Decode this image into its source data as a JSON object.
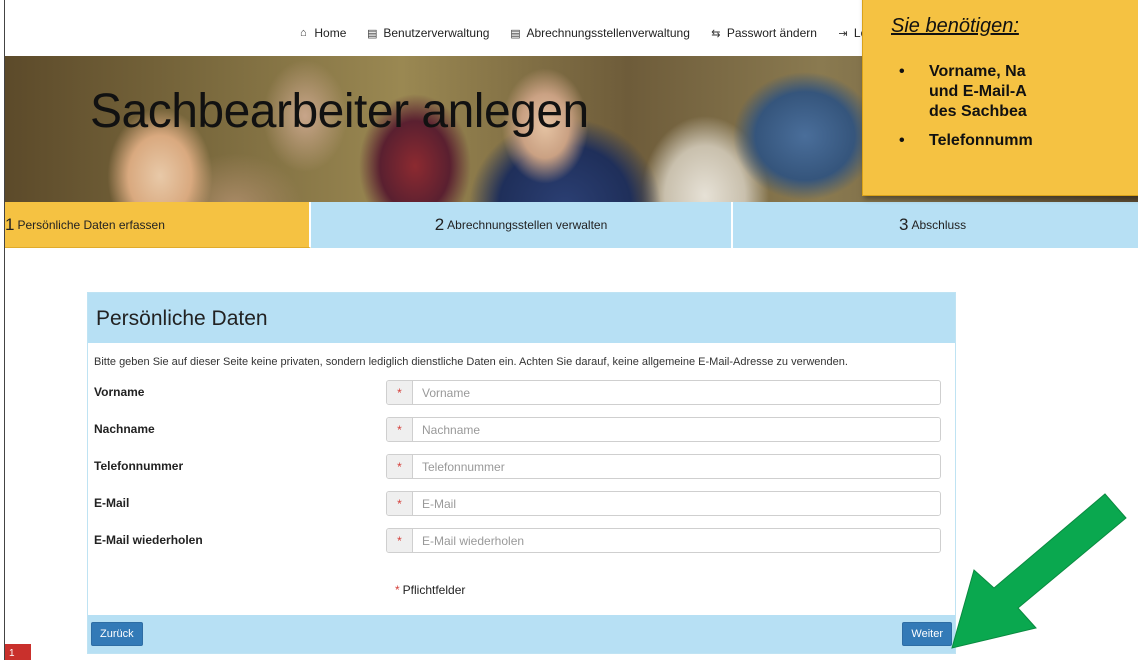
{
  "nav": {
    "items": [
      {
        "icon": "home-icon",
        "glyph": "⌂",
        "label": "Home"
      },
      {
        "icon": "list-icon",
        "glyph": "▤",
        "label": "Benutzerverwaltung"
      },
      {
        "icon": "list-icon",
        "glyph": "▤",
        "label": "Abrechnungsstellenverwaltung"
      },
      {
        "icon": "swap-icon",
        "glyph": "⇆",
        "label": "Passwort ändern"
      },
      {
        "icon": "logout-icon",
        "glyph": "⇥",
        "label": "Logout"
      }
    ]
  },
  "hero": {
    "title": "Sachbearbeiter anlegen"
  },
  "callout": {
    "heading": "Sie benötigen:",
    "items": [
      "Vorname, Na\nund E-Mail-A\ndes Sachbea",
      "Telefonnumm"
    ],
    "color": "#f5c242"
  },
  "steps": [
    {
      "num": "1",
      "label": "Persönliche Daten erfassen",
      "active": true
    },
    {
      "num": "2",
      "label": "Abrechnungsstellen verwalten",
      "active": false
    },
    {
      "num": "3",
      "label": "Abschluss",
      "active": false
    }
  ],
  "form": {
    "title": "Persönliche Daten",
    "note": "Bitte geben Sie auf dieser Seite keine privaten, sondern lediglich dienstliche Daten ein. Achten Sie darauf, keine allgemeine E-Mail-Adresse zu verwenden.",
    "fields": [
      {
        "label": "Vorname",
        "placeholder": "Vorname",
        "value": ""
      },
      {
        "label": "Nachname",
        "placeholder": "Nachname",
        "value": ""
      },
      {
        "label": "Telefonnummer",
        "placeholder": "Telefonnummer",
        "value": ""
      },
      {
        "label": "E-Mail",
        "placeholder": "E-Mail",
        "value": ""
      },
      {
        "label": "E-Mail wiederholen",
        "placeholder": "E-Mail wiederholen",
        "value": ""
      }
    ],
    "required_marker": "*",
    "required_note": "Pflichtfelder",
    "back_label": "Zurück",
    "next_label": "Weiter"
  },
  "badge": {
    "text": "1"
  },
  "colors": {
    "accent_yellow": "#f5c242",
    "accent_blue": "#b7e0f4",
    "button_blue": "#337ab7",
    "arrow_green": "#0aa84f",
    "required_red": "#d43f3a"
  }
}
